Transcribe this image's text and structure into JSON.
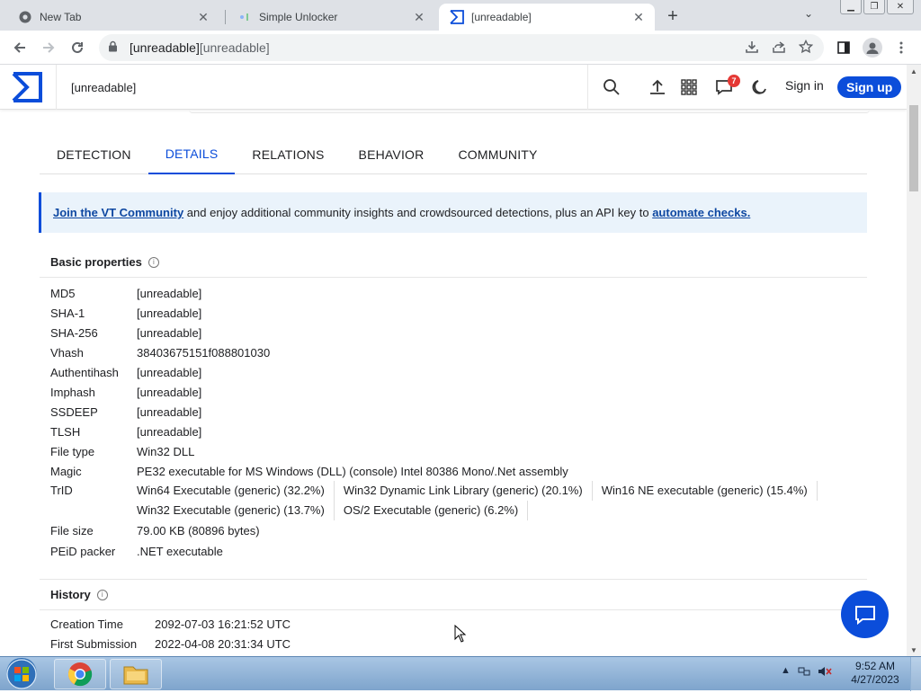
{
  "browser": {
    "tabs": [
      {
        "title": "New Tab",
        "active": false
      },
      {
        "title": "Simple Unlocker",
        "active": false
      },
      {
        "title": "[unreadable]",
        "active": true
      }
    ],
    "new_tab_symbol": "+",
    "tab_search_symbol": "⌄",
    "close_symbol": "✕",
    "window_buttons": {
      "minimize": "▁",
      "restore": "❐",
      "close": "✕"
    },
    "url_host": "[unreadable]",
    "url_path": "[unreadable]"
  },
  "vt": {
    "search_value": "[unreadable]",
    "notification_count": "7",
    "sign_in": "Sign in",
    "sign_up": "Sign up",
    "tabs": [
      "DETECTION",
      "DETAILS",
      "RELATIONS",
      "BEHAVIOR",
      "COMMUNITY"
    ],
    "active_tab": "DETAILS",
    "banner": {
      "link1": "Join the VT Community",
      "text": " and enjoy additional community insights and crowdsourced detections, plus an API key to ",
      "link2": "automate checks."
    },
    "basic": {
      "title": "Basic properties",
      "rows": [
        {
          "key": "MD5",
          "value": "[unreadable]"
        },
        {
          "key": "SHA-1",
          "value": "[unreadable]"
        },
        {
          "key": "SHA-256",
          "value": "[unreadable]"
        },
        {
          "key": "Vhash",
          "value": "38403675151f088801030"
        },
        {
          "key": "Authentihash",
          "value": "[unreadable]"
        },
        {
          "key": "Imphash",
          "value": "[unreadable]"
        },
        {
          "key": "SSDEEP",
          "value": "[unreadable]"
        },
        {
          "key": "TLSH",
          "value": "[unreadable]"
        },
        {
          "key": "File type",
          "value": "Win32 DLL"
        },
        {
          "key": "Magic",
          "value": "PE32 executable for MS Windows (DLL) (console) Intel 80386 Mono/.Net assembly"
        }
      ],
      "trid_key": "TrID",
      "trid": [
        "Win64 Executable (generic) (32.2%)",
        "Win32 Dynamic Link Library (generic) (20.1%)",
        "Win16 NE executable (generic) (15.4%)",
        "Win32 Executable (generic) (13.7%)",
        "OS/2 Executable (generic) (6.2%)"
      ],
      "tail_rows": [
        {
          "key": "File size",
          "value": "79.00 KB (80896 bytes)"
        },
        {
          "key": "PEiD packer",
          "value": ".NET executable"
        }
      ]
    },
    "history": {
      "title": "History",
      "rows": [
        {
          "key": "Creation Time",
          "value": "2092-07-03 16:21:52 UTC"
        },
        {
          "key": "First Submission",
          "value": "2022-04-08 20:31:34 UTC"
        }
      ]
    }
  },
  "taskbar": {
    "time": "9:52 AM",
    "date": "4/27/2023"
  },
  "colors": {
    "vt_blue": "#0b4dda",
    "banner_bg": "#eaf3fb",
    "taskbar": "#a9c6e4"
  }
}
